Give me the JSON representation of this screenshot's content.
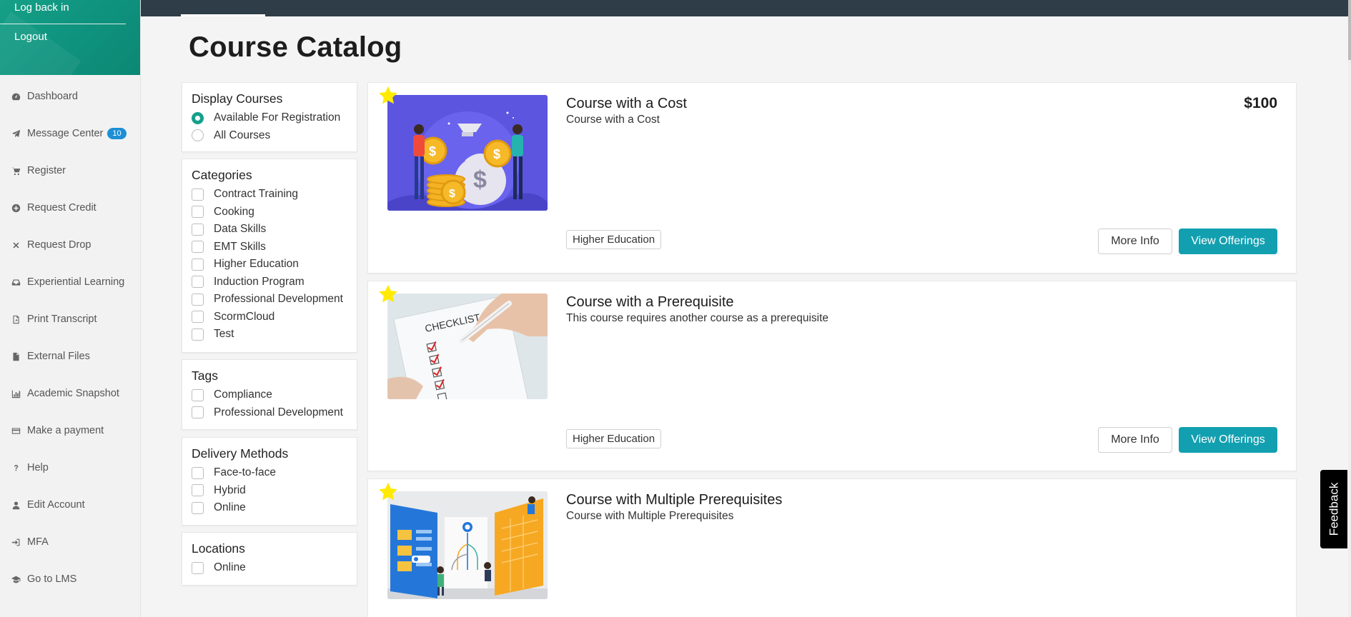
{
  "sidebar": {
    "top_links": [
      "Log back in",
      "Logout"
    ],
    "items": [
      {
        "label": "Dashboard",
        "icon": "dashboard-icon"
      },
      {
        "label": "Message Center",
        "icon": "paper-plane-icon",
        "badge": "10"
      },
      {
        "label": "Register",
        "icon": "cart-icon"
      },
      {
        "label": "Request Credit",
        "icon": "plus-circle-icon"
      },
      {
        "label": "Request Drop",
        "icon": "close-icon"
      },
      {
        "label": "Experiential Learning",
        "icon": "inbox-icon"
      },
      {
        "label": "Print Transcript",
        "icon": "pdf-file-icon"
      },
      {
        "label": "External Files",
        "icon": "file-icon"
      },
      {
        "label": "Academic Snapshot",
        "icon": "bar-chart-icon"
      },
      {
        "label": "Make a payment",
        "icon": "credit-card-icon"
      },
      {
        "label": "Help",
        "icon": "question-icon"
      },
      {
        "label": "Edit Account",
        "icon": "user-icon"
      },
      {
        "label": "MFA",
        "icon": "sign-in-icon"
      },
      {
        "label": "Go to LMS",
        "icon": "graduation-cap-icon"
      }
    ]
  },
  "page": {
    "title": "Course Catalog"
  },
  "filters": {
    "display": {
      "title": "Display Courses",
      "options": [
        "Available For Registration",
        "All Courses"
      ],
      "selected": "Available For Registration"
    },
    "categories": {
      "title": "Categories",
      "options": [
        "Contract Training",
        "Cooking",
        "Data Skills",
        "EMT Skills",
        "Higher Education",
        "Induction Program",
        "Professional Development",
        "ScormCloud",
        "Test"
      ]
    },
    "tags": {
      "title": "Tags",
      "options": [
        "Compliance",
        "Professional Development"
      ]
    },
    "delivery": {
      "title": "Delivery Methods",
      "options": [
        "Face-to-face",
        "Hybrid",
        "Online"
      ]
    },
    "locations": {
      "title": "Locations",
      "options": [
        "Online"
      ]
    }
  },
  "courses": [
    {
      "title": "Course with a Cost",
      "description": "Course with a Cost",
      "price": "$100",
      "tag": "Higher Education",
      "more_label": "More Info",
      "view_label": "View Offerings"
    },
    {
      "title": "Course with a Prerequisite",
      "description": "This course requires another course as a prerequisite",
      "price": "",
      "tag": "Higher Education",
      "more_label": "More Info",
      "view_label": "View Offerings"
    },
    {
      "title": "Course with Multiple Prerequisites",
      "description": "Course with Multiple Prerequisites",
      "price": "",
      "tag": "",
      "more_label": "",
      "view_label": ""
    }
  ],
  "thumbnails": {
    "checklist_text": "CHECKLIST"
  },
  "feedback": {
    "label": "Feedback"
  },
  "colors": {
    "sidebar_top": "#16a086",
    "accent": "#12a0b0",
    "topbar": "#2e3d48",
    "star": "#ffea00",
    "badge": "#1c8fd6"
  }
}
